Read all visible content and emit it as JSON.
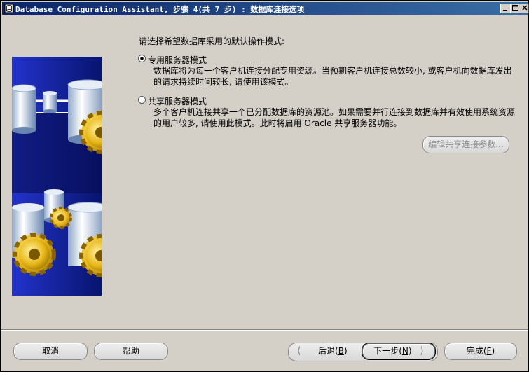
{
  "window": {
    "title": "Database Configuration Assistant, 步骤 4(共 7 步) : 数据库连接选项",
    "icon": "database-app-icon",
    "controls": [
      "minimize-icon",
      "maximize-icon",
      "close-icon"
    ]
  },
  "main": {
    "heading": "请选择希望数据库采用的默认操作模式:",
    "options": [
      {
        "label": "专用服务器模式",
        "selected": true,
        "description_lines": [
          "数据库将为每一个客户机连接分配专用资源。当预期客户机连接总数较小, 或客户机向数据库发出",
          "的请求持续时间较长, 请使用该模式。"
        ]
      },
      {
        "label": "共享服务器模式",
        "selected": false,
        "description_lines": [
          "多个客户机连接共享一个已分配数据库的资源池。如果需要并行连接到数据库并有效使用系统资源",
          "的用户较多, 请使用此模式。此时将启用 Oracle 共享服务器功能。"
        ]
      }
    ],
    "edit_shared_params_label": "编辑共享连接参数..."
  },
  "footer": {
    "cancel_label": "取消",
    "help_label": "帮助",
    "back_label": "后退",
    "back_key": "B",
    "next_label": "下一步",
    "next_key": "N",
    "finish_label": "完成",
    "finish_key": "F"
  },
  "colors": {
    "titlebar_start": "#0a246a",
    "titlebar_end": "#3a6ea5",
    "window_bg": "#d4d0c8",
    "banner_blue": "#0c1f8c",
    "gear_gold": "#e8b81a"
  }
}
